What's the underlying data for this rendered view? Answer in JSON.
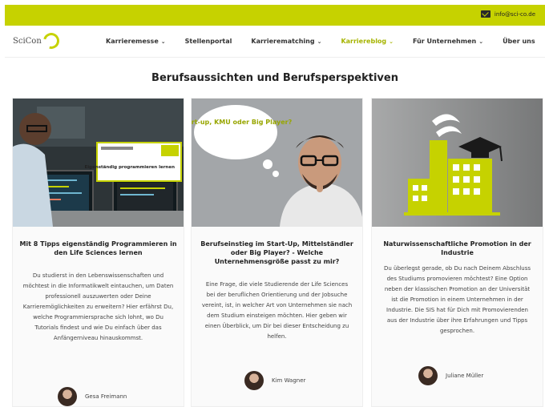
{
  "topbar": {
    "email": "info@sci-co.de"
  },
  "logo": {
    "text": "SciCon"
  },
  "nav": [
    {
      "label": "Karrieremesse",
      "chevron": true,
      "active": false
    },
    {
      "label": "Stellenportal",
      "chevron": false,
      "active": false
    },
    {
      "label": "Karrierematching",
      "chevron": true,
      "active": false
    },
    {
      "label": "Karriereblog",
      "chevron": true,
      "active": true
    },
    {
      "label": "Für Unternehmen",
      "chevron": true,
      "active": false
    },
    {
      "label": "Über uns",
      "chevron": false,
      "active": false
    }
  ],
  "page_title": "Berufsaussichten und Berufsperspektiven",
  "cards": [
    {
      "image_overlay_title": "Eigenständig programmieren lernen",
      "title": "Mit 8 Tipps eigenständig Programmieren in den Life Sciences lernen",
      "text": "Du studierst in den Lebenswissenschaften und möchtest in die Informatikwelt eintauchen, um Daten professionell auszuwerten oder Deine Karrieremöglichkeiten zu erweitern? Hier erfährst Du, welche Programmiersprache sich lohnt, wo Du Tutorials findest und wie Du einfach über das Anfängerniveau hinauskommst.",
      "author": "Gesa Freimann"
    },
    {
      "image_bubble": "Start-up, KMU oder Big Player?",
      "title": "Berufseinstieg im Start-Up, Mittelständler oder Big Player? - Welche Unternehmensgröße passt zu mir?",
      "text": "Eine Frage, die viele Studierende der Life Sciences bei der beruflichen Orientierung und der Jobsuche vereint, ist, in welcher Art von Unternehmen sie nach dem Studium einsteigen möchten. Hier geben wir einen Überblick, um Dir bei dieser Entscheidung zu helfen.",
      "author": "Kim Wagner"
    },
    {
      "title": "Naturwissenschaftliche Promotion in der Industrie",
      "text": "Du überlegst gerade, ob Du nach Deinem Abschluss des Studiums promovieren möchtest? Eine Option neben der klassischen Promotion an der Universität ist die Promotion in einem Unternehmen in der Industrie. Die SIS hat für Dich mit Promovierenden aus der Industrie über ihre Erfahrungen und Tipps gesprochen.",
      "author": "Juliane Müller"
    }
  ]
}
